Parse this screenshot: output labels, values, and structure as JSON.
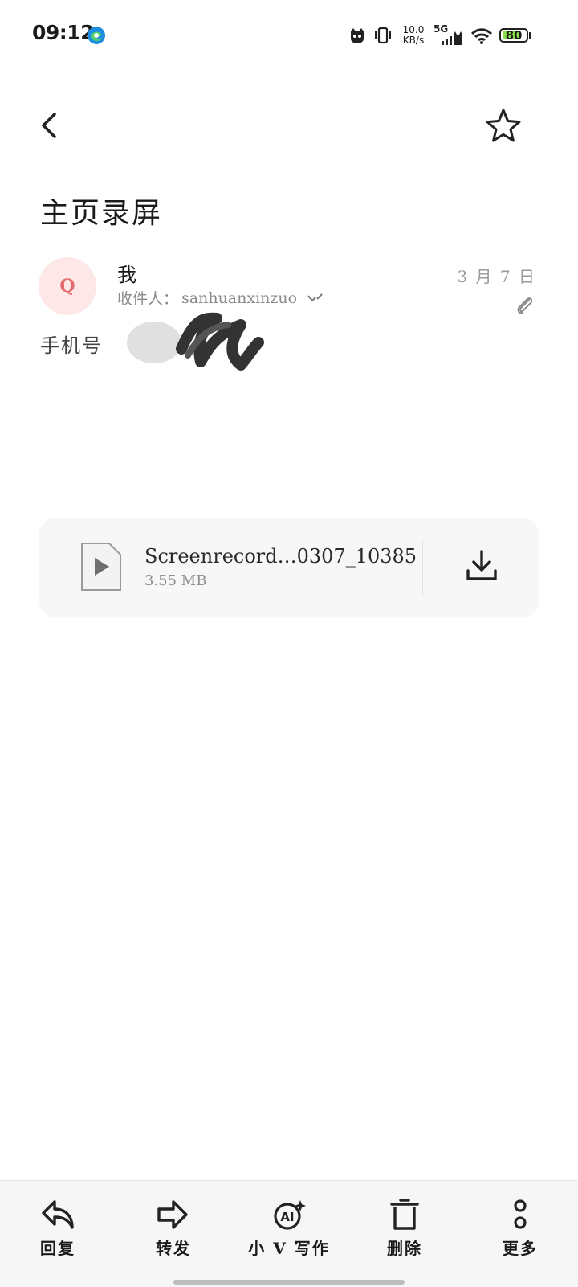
{
  "status_bar": {
    "time": "09:12",
    "net_speed_value": "10.0",
    "net_speed_unit": "KB/s",
    "signal_label": "5G",
    "battery": "80",
    "battery_level_percent": 80,
    "icons": [
      "edge-browser-icon",
      "cat-app-icon",
      "vibrate-icon",
      "signal-icon",
      "wifi-icon",
      "battery-icon"
    ]
  },
  "header": {
    "back_icon": "chevron-left-icon",
    "star_icon": "star-outline-icon"
  },
  "email": {
    "subject": "主页录屏",
    "avatar_letter": "Q",
    "sender": "我",
    "recipient_label": "收件人：",
    "recipient": "sanhuanxinzuo",
    "date": "3 月 7 日",
    "body": "手机号"
  },
  "attachment": {
    "file_name": "Screenrecord…0307_10385",
    "file_size": "3.55 MB",
    "icon": "video-file-icon",
    "download_icon": "download-icon"
  },
  "actions": [
    {
      "label": "回复",
      "icon": "reply-icon"
    },
    {
      "label": "转发",
      "icon": "forward-icon"
    },
    {
      "label": "小 V 写作",
      "icon": "ai-write-icon"
    },
    {
      "label": "删除",
      "icon": "trash-icon"
    },
    {
      "label": "更多",
      "icon": "more-icon"
    }
  ],
  "colors": {
    "avatar_bg": "#fde7e7",
    "avatar_text": "#e26a6a",
    "battery_fill": "#8be04a"
  }
}
